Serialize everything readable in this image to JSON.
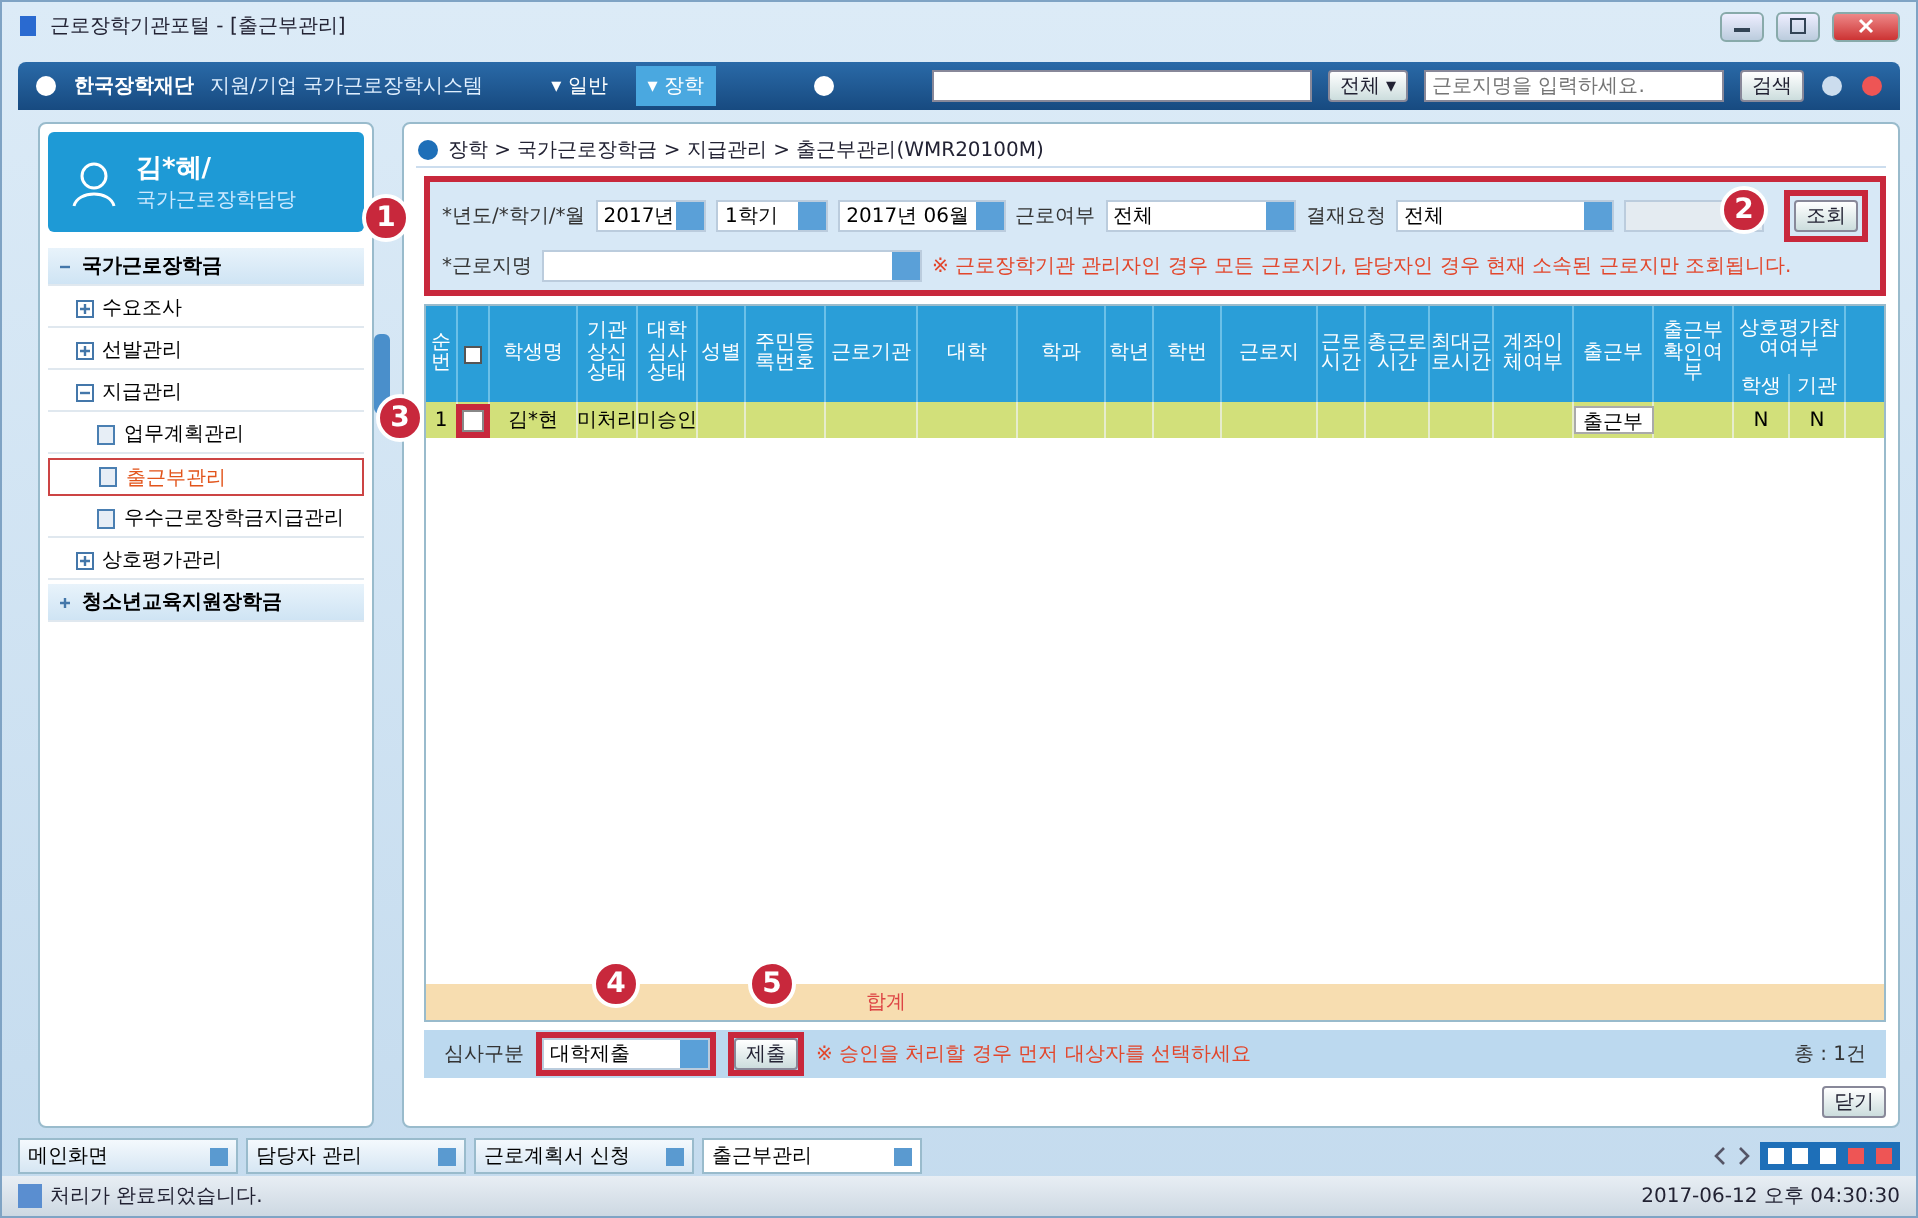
{
  "window": {
    "title": "근로장학기관포털 - [출근부관리]"
  },
  "nav": {
    "logo": "한국장학재단",
    "system": "지원/기업 국가근로장학시스템",
    "menus": [
      {
        "label": "▾ 일반",
        "selected": false
      },
      {
        "label": "▾ 장학",
        "selected": true
      }
    ],
    "scope": "전체 ▾",
    "search": {
      "placeholder": "근로지명을 입력하세요."
    },
    "search_button": "검색"
  },
  "sidebar": {
    "user": "김*혜/",
    "user_sub": "국가근로장학담당",
    "items": [
      {
        "label": "국가근로장학금",
        "kind": "group",
        "expanded": true,
        "children": [
          {
            "label": "수요조사",
            "kind": "node",
            "expanded": false
          },
          {
            "label": "선발관리",
            "kind": "node",
            "expanded": false
          },
          {
            "label": "지급관리",
            "kind": "node",
            "expanded": true,
            "children": [
              {
                "label": "업무계획관리",
                "kind": "leaf",
                "selected": false
              },
              {
                "label": "출근부관리",
                "kind": "leaf",
                "selected": true
              },
              {
                "label": "우수근로장학금지급관리",
                "kind": "leaf",
                "selected": false
              }
            ]
          },
          {
            "label": "상호평가관리",
            "kind": "node",
            "expanded": false
          }
        ]
      },
      {
        "label": "청소년교육지원장학금",
        "kind": "group",
        "expanded": false
      }
    ]
  },
  "breadcrumb": "장학 > 국가근로장학금 > 지급관리 > 출근부관리(WMR20100M)",
  "filter": {
    "callout": "1",
    "period_label": "*년도/*학기/*월",
    "year": "2017년",
    "term": "1학기",
    "month": "2017년 06월",
    "work_label": "근로여부",
    "work": "전체",
    "approval_label": "결재요청",
    "approval": "전체",
    "place_label": "*근로지명",
    "notice": "※ 근로장학기관 관리자인 경우 모든 근로지가, 담당자인 경우 현재 소속된 근로지만 조회됩니다.",
    "search_button": "조회",
    "search_callout": "2"
  },
  "table": {
    "columns": [
      {
        "label": "순번"
      },
      {
        "kind": "check"
      },
      {
        "label": "학생명"
      },
      {
        "label": "기관상신상태"
      },
      {
        "label": "대학심사상태"
      },
      {
        "label": "성별"
      },
      {
        "label": "주민등록번호"
      },
      {
        "label": "근로기관"
      },
      {
        "label": "대학"
      },
      {
        "label": "학과"
      },
      {
        "label": "학년"
      },
      {
        "label": "학번"
      },
      {
        "label": "근로지"
      },
      {
        "label": "근로시간"
      },
      {
        "label": "총근로시간"
      },
      {
        "label": "최대근로시간"
      },
      {
        "label": "계좌이체여부"
      },
      {
        "label": "출근부"
      },
      {
        "label": "출근부확인여부"
      },
      {
        "label": "상호평가참여여부",
        "sub": [
          "학생",
          "기관"
        ]
      }
    ],
    "rows": [
      {
        "selected": true,
        "checked": false,
        "callout": "3",
        "cells": [
          "1",
          "",
          "김*현",
          "미처리",
          "미승인",
          "",
          "",
          "",
          "",
          "",
          "",
          "",
          "",
          "",
          "",
          "",
          "",
          "출근부",
          "",
          "N",
          "N"
        ]
      }
    ],
    "total_label": "합계"
  },
  "bottom": {
    "review_label": "심사구분",
    "review": "대학제출",
    "review_callout": "4",
    "submit": "제출",
    "submit_callout": "5",
    "notice": "※ 승인을 처리할 경우 먼저 대상자를 선택하세요",
    "count": "총 : 1건"
  },
  "close_button": "닫기",
  "tabs": [
    {
      "label": "메인화면",
      "selected": false
    },
    {
      "label": "담당자 관리",
      "selected": false
    },
    {
      "label": "근로계획서 신청",
      "selected": false
    },
    {
      "label": "출근부관리",
      "selected": true
    }
  ],
  "status": {
    "message": "처리가 완료되었습니다.",
    "time": "2017-06-12 오후 04:30:30"
  }
}
